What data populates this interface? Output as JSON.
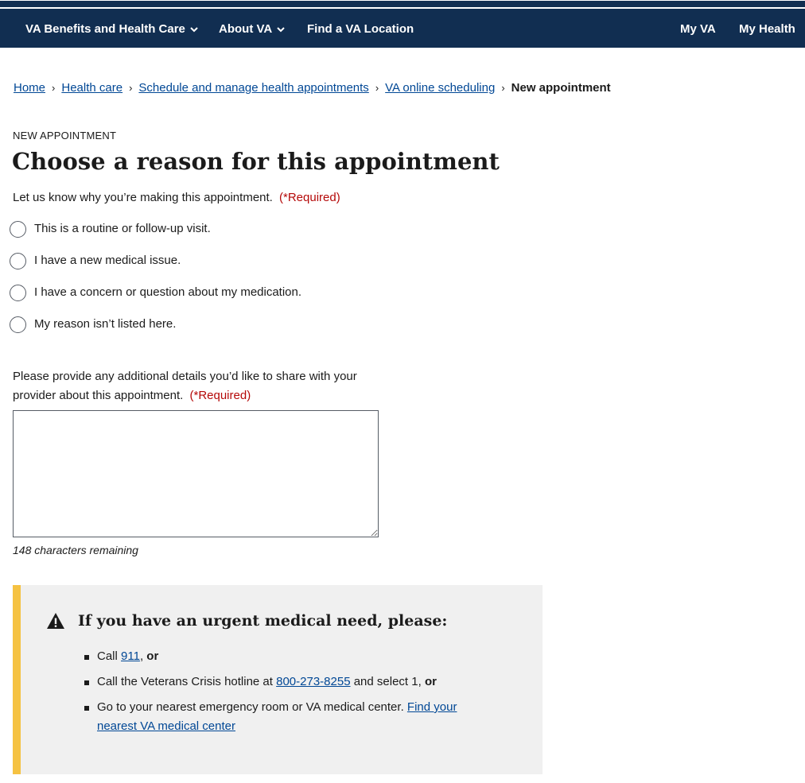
{
  "header": {
    "nav": [
      {
        "label": "VA Benefits and Health Care"
      },
      {
        "label": "About VA"
      },
      {
        "label": "Find a VA Location"
      },
      {
        "label": "My VA"
      },
      {
        "label": "My Health"
      }
    ]
  },
  "breadcrumb": {
    "items": [
      "Home",
      "Health care",
      "Schedule and manage health appointments",
      "VA online scheduling"
    ],
    "current": "New appointment",
    "separator": "›"
  },
  "page": {
    "eyebrow": "NEW APPOINTMENT",
    "title": "Choose a reason for this appointment",
    "intro": "Let us know why you’re making this appointment.",
    "required": "(*Required)"
  },
  "reasons": [
    "This is a routine or follow-up visit.",
    "I have a new medical issue.",
    "I have a concern or question about my medication.",
    "My reason isn’t listed here."
  ],
  "details": {
    "label": "Please provide any additional details you’d like to share with your provider about this appointment.",
    "required": "(*Required)",
    "value": "",
    "counter": "148 characters remaining"
  },
  "alert": {
    "title": "If you have an urgent medical need, please:",
    "items": {
      "call_prefix": "Call",
      "call_number": "911",
      "call_suffix": ", ",
      "or": "or",
      "hotline_prefix": "Call the Veterans Crisis hotline at",
      "hotline_number": "800-273-8255",
      "hotline_suffix": "and select 1,",
      "er_text": "Go to your nearest emergency room or VA medical center.",
      "er_link": "Find your nearest VA medical center"
    }
  },
  "colors": {
    "nav_bg": "#112e51",
    "link": "#004795",
    "required": "#b50909",
    "alert_bg": "#f0f0f0",
    "alert_border": "#f5c242"
  }
}
